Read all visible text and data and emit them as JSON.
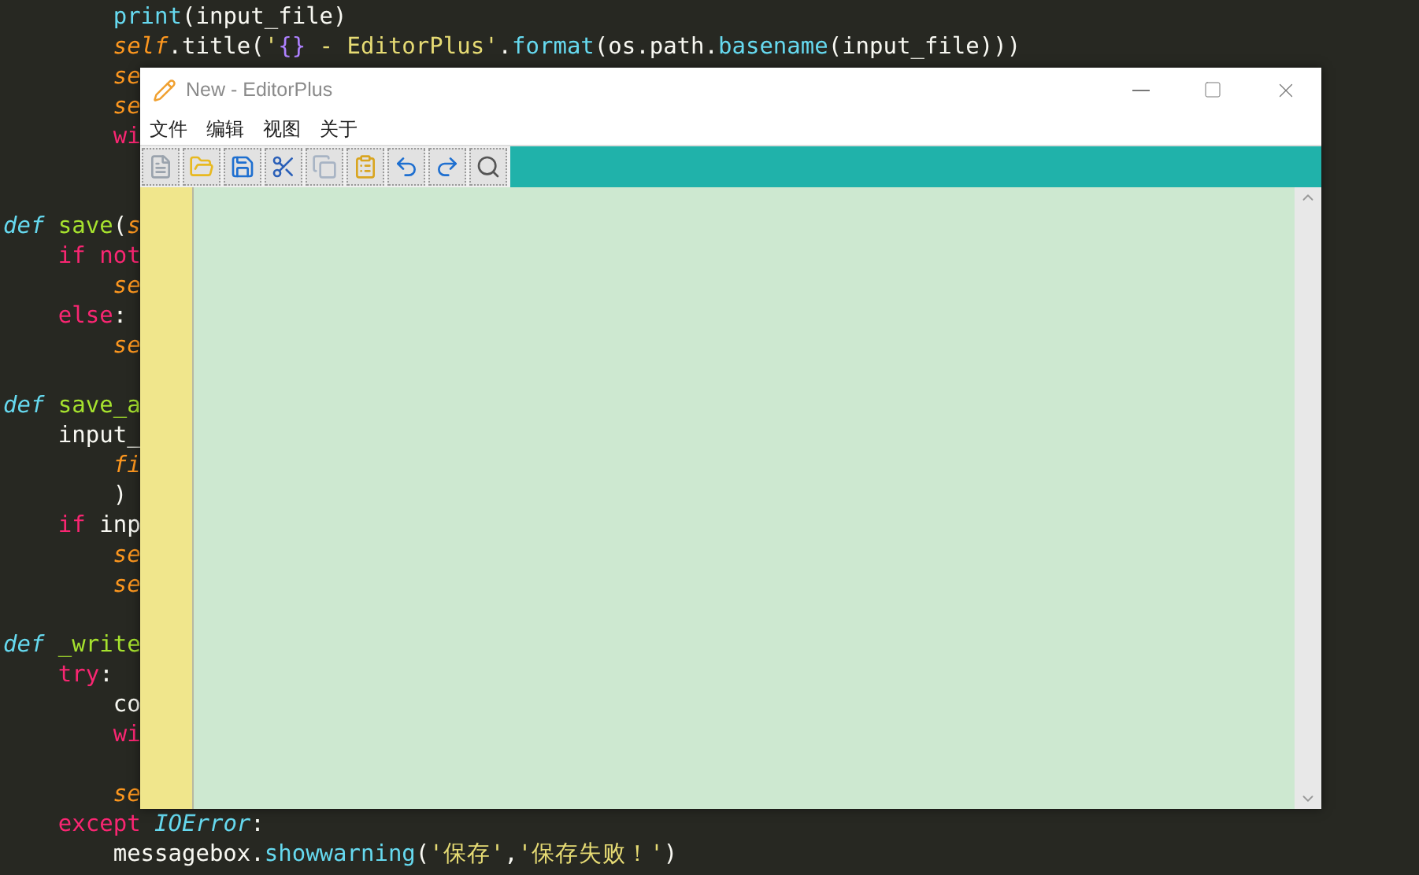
{
  "code_lines": [
    {
      "kind": "code",
      "tokens": [
        {
          "text": "        print",
          "kind": "builtin"
        },
        {
          "text": "(input_file)"
        }
      ]
    },
    {
      "kind": "code",
      "tokens": [
        {
          "text": "        self",
          "kind": "self"
        },
        {
          "text": ".title("
        },
        {
          "text": "'",
          "kind": "string"
        },
        {
          "text": "{}",
          "kind": "constant"
        },
        {
          "text": " - EditorPlus'",
          "kind": "string"
        },
        {
          "text": "."
        },
        {
          "text": "format",
          "kind": "builtin"
        },
        {
          "text": "(os.path."
        },
        {
          "text": "basename",
          "kind": "builtin"
        },
        {
          "text": "(input_file)))"
        }
      ]
    },
    {
      "kind": "code",
      "tokens": [
        {
          "text": "        se",
          "kind": "self"
        }
      ]
    },
    {
      "kind": "code",
      "tokens": [
        {
          "text": "        se",
          "kind": "self"
        }
      ]
    },
    {
      "kind": "code",
      "tokens": [
        {
          "text": "        wi",
          "kind": "keyword"
        }
      ]
    },
    {
      "kind": "blank"
    },
    {
      "kind": "blank"
    },
    {
      "kind": "code",
      "tokens": [
        {
          "text": "def",
          "kind": "def"
        },
        {
          "text": " save",
          "kind": "function"
        },
        {
          "text": "("
        },
        {
          "text": "s",
          "kind": "self"
        }
      ]
    },
    {
      "kind": "code",
      "tokens": [
        {
          "text": "    if not",
          "kind": "keyword"
        }
      ]
    },
    {
      "kind": "code",
      "tokens": [
        {
          "text": "        se",
          "kind": "self"
        }
      ]
    },
    {
      "kind": "code",
      "tokens": [
        {
          "text": "    else",
          "kind": "keyword"
        },
        {
          "text": ":"
        }
      ]
    },
    {
      "kind": "code",
      "tokens": [
        {
          "text": "        se",
          "kind": "self"
        }
      ]
    },
    {
      "kind": "blank"
    },
    {
      "kind": "code",
      "tokens": [
        {
          "text": "def",
          "kind": "def"
        },
        {
          "text": " save_a",
          "kind": "function"
        }
      ]
    },
    {
      "kind": "code",
      "tokens": [
        {
          "text": "    input_"
        }
      ]
    },
    {
      "kind": "code",
      "tokens": [
        {
          "text": "        fi",
          "kind": "self"
        }
      ]
    },
    {
      "kind": "code",
      "tokens": [
        {
          "text": "        )"
        }
      ]
    },
    {
      "kind": "code",
      "tokens": [
        {
          "text": "    if",
          "kind": "keyword"
        },
        {
          "text": " inp"
        }
      ]
    },
    {
      "kind": "code",
      "tokens": [
        {
          "text": "        se",
          "kind": "self"
        }
      ]
    },
    {
      "kind": "code",
      "tokens": [
        {
          "text": "        se",
          "kind": "self"
        }
      ]
    },
    {
      "kind": "blank"
    },
    {
      "kind": "code",
      "tokens": [
        {
          "text": "def",
          "kind": "def"
        },
        {
          "text": " _write",
          "kind": "function"
        }
      ]
    },
    {
      "kind": "code",
      "tokens": [
        {
          "text": "    try",
          "kind": "keyword"
        },
        {
          "text": ":"
        }
      ]
    },
    {
      "kind": "code",
      "tokens": [
        {
          "text": "        co"
        }
      ]
    },
    {
      "kind": "code",
      "tokens": [
        {
          "text": "        wi",
          "kind": "keyword"
        }
      ]
    },
    {
      "kind": "blank"
    },
    {
      "kind": "code",
      "tokens": [
        {
          "text": "        se",
          "kind": "self"
        }
      ]
    },
    {
      "kind": "code",
      "tokens": [
        {
          "text": "    except",
          "kind": "keyword"
        },
        {
          "text": " IOError",
          "kind": "class"
        },
        {
          "text": ":"
        }
      ]
    },
    {
      "kind": "code",
      "tokens": [
        {
          "text": "        messagebox."
        },
        {
          "text": "showwarning",
          "kind": "builtin"
        },
        {
          "text": "("
        },
        {
          "text": "'保存'",
          "kind": "string"
        },
        {
          "text": ","
        },
        {
          "text": "'保存失败！'",
          "kind": "string"
        },
        {
          "text": ")"
        }
      ]
    }
  ],
  "window": {
    "title": "New - EditorPlus",
    "menu": [
      "文件",
      "编辑",
      "视图",
      "关于"
    ],
    "toolbar": [
      {
        "kind": "new"
      },
      {
        "kind": "open"
      },
      {
        "kind": "save"
      },
      {
        "kind": "cut"
      },
      {
        "kind": "copy"
      },
      {
        "kind": "paste"
      },
      {
        "kind": "undo"
      },
      {
        "kind": "redo"
      },
      {
        "kind": "find"
      }
    ]
  }
}
